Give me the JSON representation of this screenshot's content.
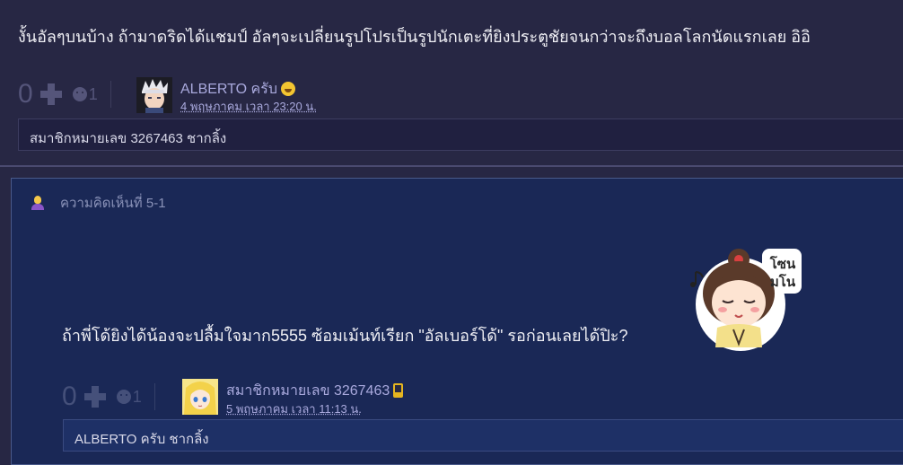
{
  "top_comment": {
    "text": "งั้นอัลๆบนบ้าง  ถ้ามาดริดได้แชมป์ อัลๆจะเปลี่ยนรูปโปรเป็นรูปนักเตะที่ยิงประตูชัยจนกว่าจะถึงบอลโลกนัดแรกเลย  อิอิ",
    "votes": "0",
    "emotions": "1",
    "author": "ALBERTO ครับ",
    "date": "4 พฤษภาคม เวลา 23:20 น.",
    "reply_preview": "สมาชิกหมายเลข 3267463 ชากลิ้ง"
  },
  "reply": {
    "label": "ความคิดเห็นที่ 5-1",
    "sticker_text": "โซนมโน",
    "text": "ถ้าพี่โด้ยิงได้น้องจะปลื้มใจมาก5555 ซ้อมเม้นท์เรียก \"อัลเบอร์โด้\" รอก่อนเลยได้ปิะ?",
    "votes": "0",
    "emotions": "1",
    "author": "สมาชิกหมายเลข 3267463",
    "date": "5 พฤษภาคม เวลา 11:13 น.",
    "reply_preview": "ALBERTO ครับ ชากลิ้ง"
  },
  "colors": {
    "page_bg": "#272744",
    "panel_bg": "#1a2856",
    "link": "#a9a9dd"
  }
}
